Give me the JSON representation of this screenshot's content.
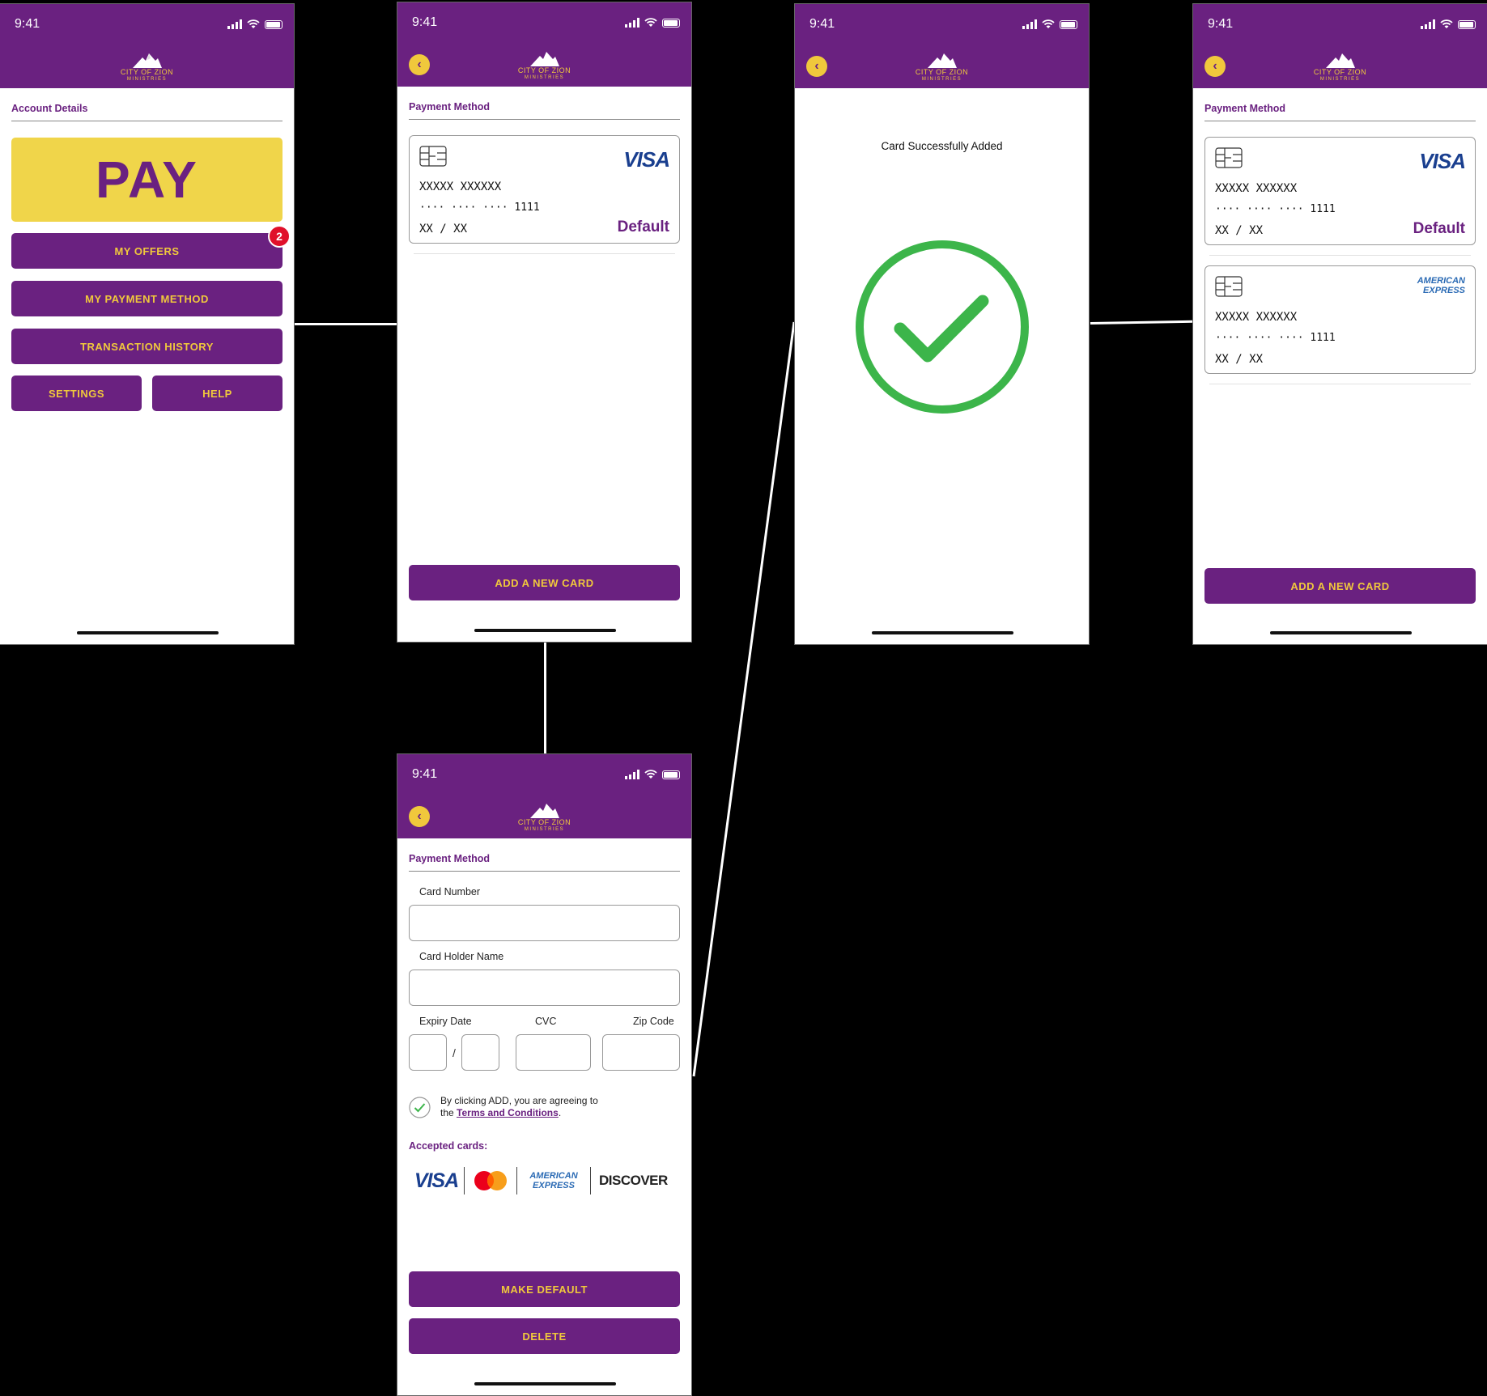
{
  "status": {
    "time": "9:41"
  },
  "logo": {
    "line1": "CITY OF ZION",
    "line2": "MINISTRIES"
  },
  "screen1": {
    "section_title": "Account Details",
    "pay_label": "PAY",
    "offers_label": "MY OFFERS",
    "offers_badge": "2",
    "payment_method_label": "MY PAYMENT METHOD",
    "history_label": "TRANSACTION HISTORY",
    "settings_label": "SETTINGS",
    "help_label": "HELP"
  },
  "screen2": {
    "section_title": "Payment Method",
    "card": {
      "brand": "VISA",
      "number1": "XXXXX XXXXXX",
      "number2": "···· ···· ···· 1111",
      "expiry": "XX / XX",
      "default": "Default"
    },
    "add_label": "ADD A NEW CARD"
  },
  "screen3": {
    "message": "Card Successfully Added"
  },
  "screen4": {
    "section_title": "Payment Method",
    "cards": [
      {
        "brand": "VISA",
        "number1": "XXXXX XXXXXX",
        "number2": "···· ···· ···· 1111",
        "expiry": "XX / XX",
        "default": "Default"
      },
      {
        "brand_line1": "AMERICAN",
        "brand_line2": "EXPRESS",
        "number1": "XXXXX XXXXXX",
        "number2": "···· ···· ···· 1111",
        "expiry": "XX / XX"
      }
    ],
    "add_label": "ADD A NEW CARD"
  },
  "screen5": {
    "section_title": "Payment Method",
    "card_number_label": "Card Number",
    "holder_label": "Card Holder Name",
    "expiry_label": "Expiry Date",
    "expiry_sep": "/",
    "cvc_label": "CVC",
    "zip_label": "Zip Code",
    "terms_prefix": "By clicking ADD, you are agreeing to",
    "terms_the": "the",
    "terms_link": "Terms and Conditions",
    "terms_suffix": ".",
    "accepted_label": "Accepted cards:",
    "brands": {
      "visa": "VISA",
      "amex1": "AMERICAN",
      "amex2": "EXPRESS",
      "discover": "DISCOVER"
    },
    "make_default_label": "MAKE DEFAULT",
    "delete_label": "DELETE"
  },
  "colors": {
    "brand_purple": "#6a2180",
    "accent_yellow": "#f0c83c",
    "success_green": "#3cb54a",
    "badge_red": "#e0102a"
  }
}
